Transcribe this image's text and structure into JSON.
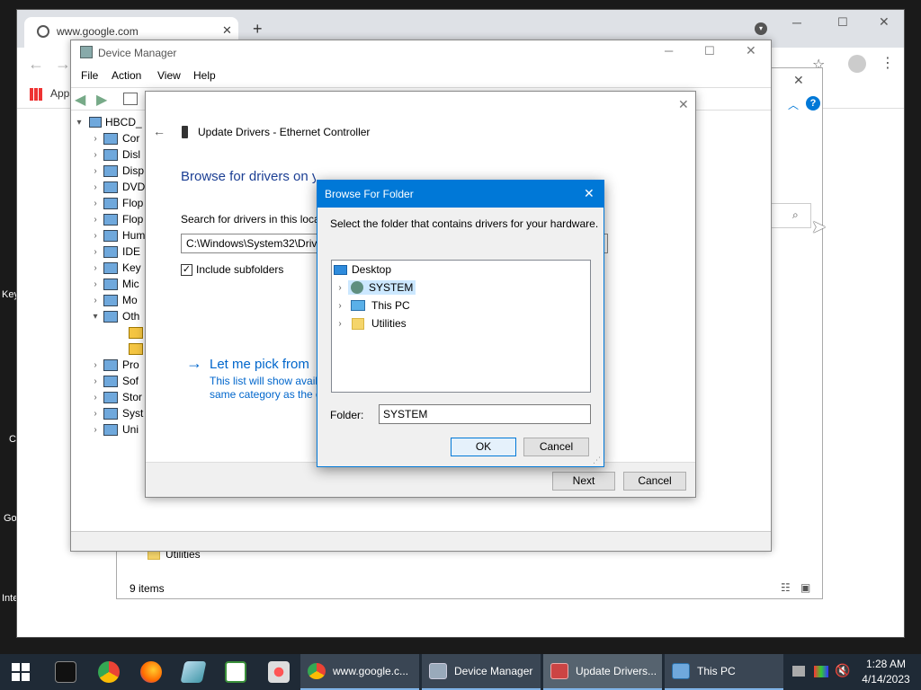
{
  "desktop_labels": [
    "Key",
    "C",
    "Go",
    "Inte"
  ],
  "chrome": {
    "tab_title": "www.google.com",
    "apps_label": "Apps"
  },
  "explorer": {
    "folder_item": "Utilities",
    "status": "9 items"
  },
  "device_manager": {
    "title": "Device Manager",
    "menu": [
      "File",
      "Action",
      "View",
      "Help"
    ],
    "root": "HBCD_",
    "tree": [
      {
        "label": "Cor",
        "expanded": false
      },
      {
        "label": "Disl",
        "expanded": false
      },
      {
        "label": "Disp",
        "expanded": false
      },
      {
        "label": "DVD",
        "expanded": false
      },
      {
        "label": "Flop",
        "expanded": false
      },
      {
        "label": "Flop",
        "expanded": false
      },
      {
        "label": "Hum",
        "expanded": false
      },
      {
        "label": "IDE",
        "expanded": false
      },
      {
        "label": "Key",
        "expanded": false
      },
      {
        "label": "Mic",
        "expanded": false
      },
      {
        "label": "Mo",
        "expanded": false
      },
      {
        "label": "Oth",
        "expanded": true
      },
      {
        "label": "",
        "expanded": null
      },
      {
        "label": "",
        "expanded": null
      },
      {
        "label": "Pro",
        "expanded": false
      },
      {
        "label": "Sof",
        "expanded": false
      },
      {
        "label": "Stor",
        "expanded": false
      },
      {
        "label": "Syst",
        "expanded": false
      },
      {
        "label": "Uni",
        "expanded": false
      }
    ]
  },
  "update_drivers": {
    "title": "Update Drivers - Ethernet Controller",
    "heading": "Browse for drivers on your computer",
    "search_label": "Search for drivers in this locat",
    "path_value": "C:\\Windows\\System32\\Driv",
    "include_subfolders": "Include subfolders",
    "include_checked": true,
    "pick_link": "Let me pick from",
    "pick_desc_1": "This list will show avail",
    "pick_desc_2": "same category as the d",
    "next_button": "Next",
    "cancel_button": "Cancel"
  },
  "browse_for_folder": {
    "title": "Browse For Folder",
    "instruction": "Select the folder that contains drivers for your hardware.",
    "tree": [
      {
        "label": "Desktop",
        "indent": 0,
        "selected": false,
        "icon": "desktop-icon"
      },
      {
        "label": "SYSTEM",
        "indent": 1,
        "selected": true,
        "icon": "user-folder-icon"
      },
      {
        "label": "This PC",
        "indent": 1,
        "selected": false,
        "icon": "computer-icon"
      },
      {
        "label": "Utilities",
        "indent": 1,
        "selected": false,
        "icon": "folder-icon"
      }
    ],
    "folder_label": "Folder:",
    "folder_value": "SYSTEM",
    "ok_button": "OK",
    "cancel_button": "Cancel"
  },
  "taskbar": {
    "tasks": [
      {
        "label": "www.google.c...",
        "icon": "chrome-icon"
      },
      {
        "label": "Device Manager",
        "icon": "device-manager-icon"
      },
      {
        "label": "Update Drivers...",
        "icon": "update-drivers-icon",
        "active": true
      },
      {
        "label": "This PC",
        "icon": "this-pc-icon"
      }
    ],
    "time": "1:28 AM",
    "date": "4/14/2023"
  },
  "colors": {
    "accent": "#0078d7",
    "link": "#0066cc",
    "taskbar": "#1f2a36"
  }
}
